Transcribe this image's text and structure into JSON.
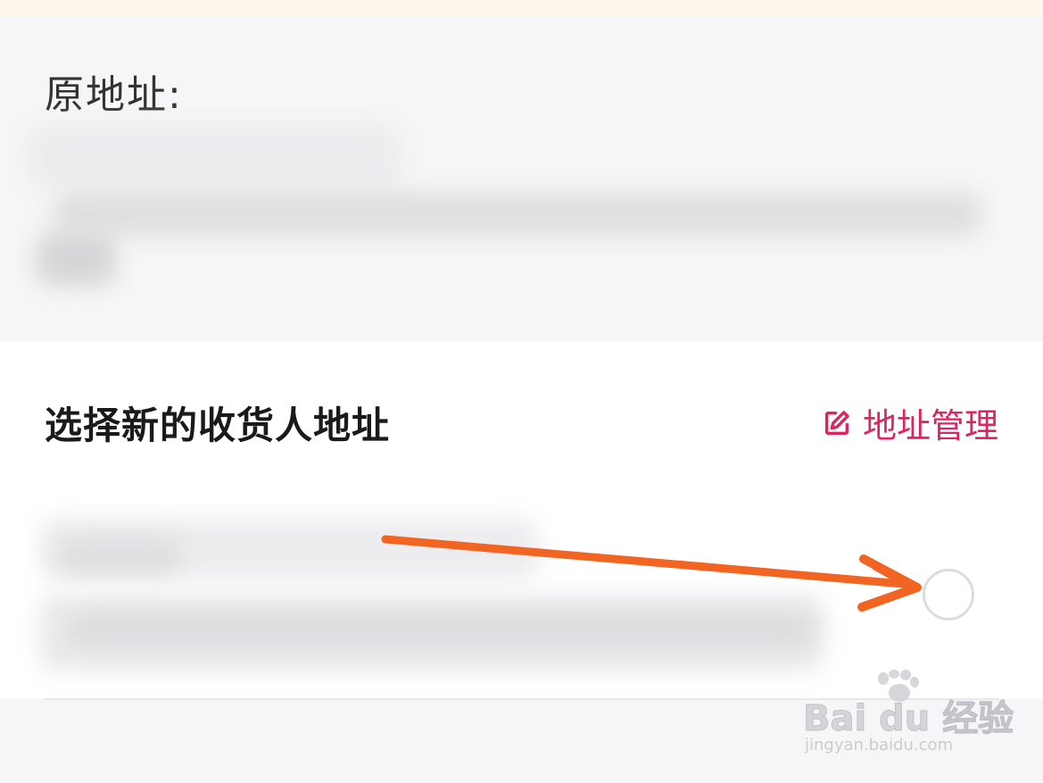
{
  "original_address": {
    "heading": "原地址:"
  },
  "new_address": {
    "heading": "选择新的收货人地址",
    "manage_link_label": "地址管理"
  },
  "watermark": {
    "brand": "Bai du 经验",
    "url": "jingyan.baidu.com"
  },
  "colors": {
    "accent": "#e0245e",
    "arrow": "#f26422",
    "background": "#f6f6f8",
    "card": "#ffffff"
  },
  "icons": {
    "manage": "edit-icon",
    "annotation": "arrow-annotation"
  }
}
